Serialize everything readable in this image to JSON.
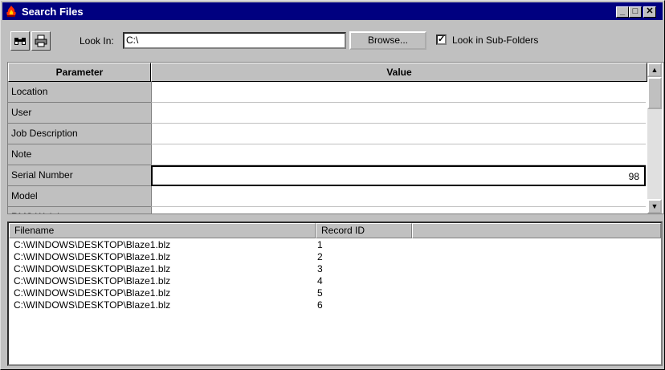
{
  "window": {
    "title": "Search Files",
    "icon": "fire-app-icon"
  },
  "toolbar": {
    "binoculars_icon": "binoculars-icon",
    "print_icon": "printer-icon",
    "look_in_label": "Look In:",
    "look_in_value": "C:\\",
    "browse_label": "Browse...",
    "subfolders_label": "Look in Sub-Folders",
    "subfolders_checked": true
  },
  "grid": {
    "headers": {
      "parameter": "Parameter",
      "value": "Value"
    },
    "rows": [
      {
        "parameter": "Location",
        "value": ""
      },
      {
        "parameter": "User",
        "value": ""
      },
      {
        "parameter": "Job Description",
        "value": ""
      },
      {
        "parameter": "Note",
        "value": ""
      },
      {
        "parameter": "Serial Number",
        "value": "98"
      },
      {
        "parameter": "Model",
        "value": ""
      },
      {
        "parameter": "RMS Weight",
        "value": ""
      }
    ]
  },
  "results": {
    "headers": {
      "filename": "Filename",
      "record_id": "Record ID"
    },
    "rows": [
      {
        "filename": "C:\\WINDOWS\\DESKTOP\\Blaze1.blz",
        "record_id": "1"
      },
      {
        "filename": "C:\\WINDOWS\\DESKTOP\\Blaze1.blz",
        "record_id": "2"
      },
      {
        "filename": "C:\\WINDOWS\\DESKTOP\\Blaze1.blz",
        "record_id": "3"
      },
      {
        "filename": "C:\\WINDOWS\\DESKTOP\\Blaze1.blz",
        "record_id": "4"
      },
      {
        "filename": "C:\\WINDOWS\\DESKTOP\\Blaze1.blz",
        "record_id": "5"
      },
      {
        "filename": "C:\\WINDOWS\\DESKTOP\\Blaze1.blz",
        "record_id": "6"
      }
    ]
  },
  "colors": {
    "titlebar": "#000080",
    "face": "#c0c0c0",
    "window": "#ffffff"
  }
}
